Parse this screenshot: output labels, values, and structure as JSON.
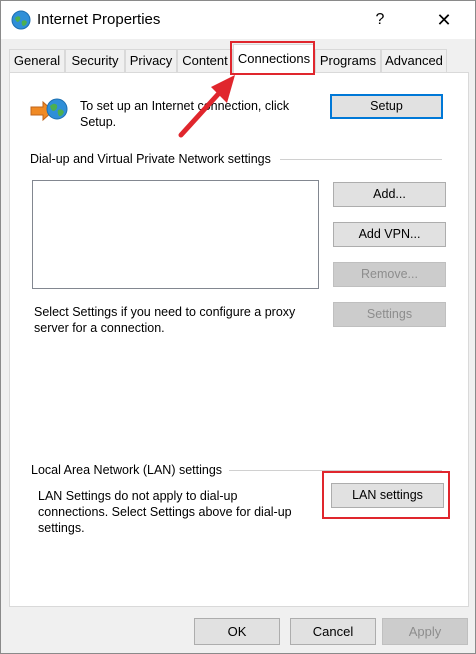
{
  "window": {
    "title": "Internet Properties",
    "help_symbol": "?",
    "close_symbol": "✕"
  },
  "tabs": [
    {
      "label": "General"
    },
    {
      "label": "Security"
    },
    {
      "label": "Privacy"
    },
    {
      "label": "Content"
    },
    {
      "label": "Connections"
    },
    {
      "label": "Programs"
    },
    {
      "label": "Advanced"
    }
  ],
  "active_tab": "Connections",
  "setup": {
    "text": "To set up an Internet connection, click Setup.",
    "button": "Setup"
  },
  "dialup": {
    "group_label": "Dial-up and Virtual Private Network settings",
    "add_button": "Add...",
    "add_vpn_button": "Add VPN...",
    "remove_button": "Remove...",
    "settings_text": "Select Settings if you need to configure a proxy server for a connection.",
    "settings_button": "Settings"
  },
  "lan": {
    "group_label": "Local Area Network (LAN) settings",
    "text": "LAN Settings do not apply to dial-up connections. Select Settings above for dial-up settings.",
    "button": "LAN settings"
  },
  "footer": {
    "ok": "OK",
    "cancel": "Cancel",
    "apply": "Apply"
  },
  "colors": {
    "highlight": "#e0262d",
    "primary_border": "#0078d7"
  },
  "icons": {
    "app": "globe-icon",
    "connection": "globe-arrow-icon",
    "annotation": "red-arrow"
  }
}
